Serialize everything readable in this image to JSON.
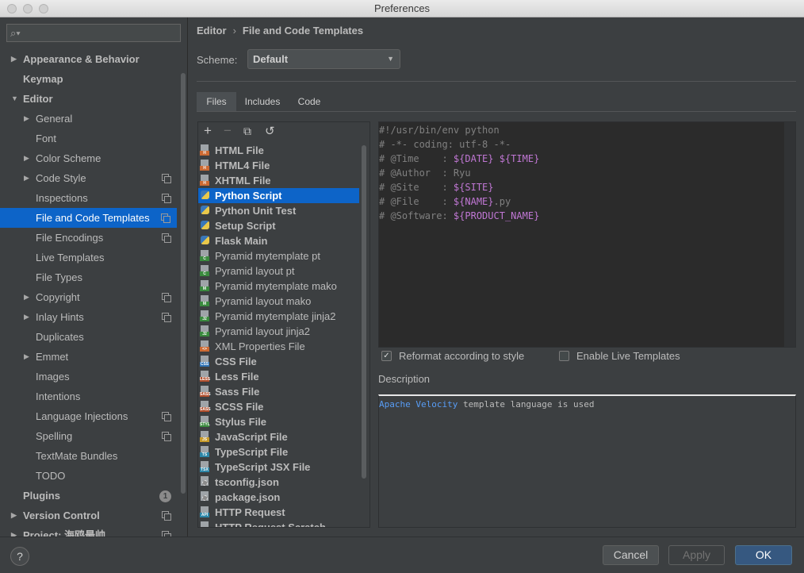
{
  "window": {
    "title": "Preferences"
  },
  "search": {
    "placeholder": ""
  },
  "sidebar": {
    "items": [
      {
        "label": "Appearance & Behavior",
        "bold": true,
        "arrow": "right",
        "level": 0
      },
      {
        "label": "Keymap",
        "bold": true,
        "level": 0
      },
      {
        "label": "Editor",
        "bold": true,
        "arrow": "down",
        "level": 0
      },
      {
        "label": "General",
        "arrow": "right",
        "level": 1
      },
      {
        "label": "Font",
        "level": 1
      },
      {
        "label": "Color Scheme",
        "arrow": "right",
        "level": 1
      },
      {
        "label": "Code Style",
        "arrow": "right",
        "level": 1,
        "copy": true
      },
      {
        "label": "Inspections",
        "level": 1,
        "copy": true
      },
      {
        "label": "File and Code Templates",
        "level": 1,
        "copy": true,
        "selected": true
      },
      {
        "label": "File Encodings",
        "level": 1,
        "copy": true
      },
      {
        "label": "Live Templates",
        "level": 1
      },
      {
        "label": "File Types",
        "level": 1
      },
      {
        "label": "Copyright",
        "arrow": "right",
        "level": 1,
        "copy": true
      },
      {
        "label": "Inlay Hints",
        "arrow": "right",
        "level": 1,
        "copy": true
      },
      {
        "label": "Duplicates",
        "level": 1
      },
      {
        "label": "Emmet",
        "arrow": "right",
        "level": 1
      },
      {
        "label": "Images",
        "level": 1
      },
      {
        "label": "Intentions",
        "level": 1
      },
      {
        "label": "Language Injections",
        "level": 1,
        "copy": true
      },
      {
        "label": "Spelling",
        "level": 1,
        "copy": true
      },
      {
        "label": "TextMate Bundles",
        "level": 1
      },
      {
        "label": "TODO",
        "level": 1
      },
      {
        "label": "Plugins",
        "bold": true,
        "level": 0,
        "badge": "1"
      },
      {
        "label": "Version Control",
        "bold": true,
        "arrow": "right",
        "level": 0,
        "copy": true
      },
      {
        "label": "Project: 海鸥最帅",
        "bold": true,
        "arrow": "right",
        "level": 0,
        "copy": true
      }
    ]
  },
  "breadcrumb": {
    "parent": "Editor",
    "separator": "›",
    "current": "File and Code Templates"
  },
  "scheme": {
    "label": "Scheme:",
    "value": "Default"
  },
  "tabs": [
    {
      "label": "Files",
      "active": true
    },
    {
      "label": "Includes"
    },
    {
      "label": "Code"
    }
  ],
  "toolbar": {
    "add": "+",
    "remove": "−",
    "copy": "⧉",
    "reset": "↺"
  },
  "files": [
    {
      "label": "HTML File",
      "bold": true,
      "icon": "html-file-icon",
      "tag": "H",
      "color": "#cc6a33"
    },
    {
      "label": "HTML4 File",
      "bold": true,
      "icon": "html-file-icon",
      "tag": "H",
      "color": "#cc6a33"
    },
    {
      "label": "XHTML File",
      "bold": true,
      "icon": "html-file-icon",
      "tag": "H",
      "color": "#cc6a33"
    },
    {
      "label": "Python Script",
      "bold": true,
      "icon": "python-icon",
      "selected": true
    },
    {
      "label": "Python Unit Test",
      "bold": true,
      "icon": "python-icon"
    },
    {
      "label": "Setup Script",
      "bold": true,
      "icon": "python-icon"
    },
    {
      "label": "Flask Main",
      "bold": true,
      "icon": "python-icon"
    },
    {
      "label": "Pyramid mytemplate pt",
      "icon": "chameleon-file-icon",
      "tag": "C",
      "color": "#3a8a3e"
    },
    {
      "label": "Pyramid layout pt",
      "icon": "chameleon-file-icon",
      "tag": "C",
      "color": "#3a8a3e"
    },
    {
      "label": "Pyramid mytemplate mako",
      "icon": "mako-file-icon",
      "tag": "M",
      "color": "#3a8a3e"
    },
    {
      "label": "Pyramid layout mako",
      "icon": "mako-file-icon",
      "tag": "M",
      "color": "#3a8a3e"
    },
    {
      "label": "Pyramid mytemplate jinja2",
      "icon": "jinja-file-icon",
      "tag": "J2",
      "color": "#3a8a3e"
    },
    {
      "label": "Pyramid layout jinja2",
      "icon": "jinja-file-icon",
      "tag": "J2",
      "color": "#3a8a3e"
    },
    {
      "label": "XML Properties File",
      "icon": "xml-file-icon",
      "tag": "<>",
      "color": "#cc6a33"
    },
    {
      "label": "CSS File",
      "bold": true,
      "icon": "css-file-icon",
      "tag": "CSS",
      "color": "#2f73b5"
    },
    {
      "label": "Less File",
      "bold": true,
      "icon": "less-file-icon",
      "tag": "LESS",
      "color": "#b04e2c"
    },
    {
      "label": "Sass File",
      "bold": true,
      "icon": "sass-file-icon",
      "tag": "SASS",
      "color": "#b04e2c"
    },
    {
      "label": "SCSS File",
      "bold": true,
      "icon": "scss-file-icon",
      "tag": "SASS",
      "color": "#b04e2c"
    },
    {
      "label": "Stylus File",
      "bold": true,
      "icon": "stylus-file-icon",
      "tag": "STYL",
      "color": "#3a8a3e"
    },
    {
      "label": "JavaScript File",
      "bold": true,
      "icon": "js-file-icon",
      "tag": "JS",
      "color": "#c79a2a"
    },
    {
      "label": "TypeScript File",
      "bold": true,
      "icon": "ts-file-icon",
      "tag": "TS",
      "color": "#2c86a8"
    },
    {
      "label": "TypeScript JSX File",
      "bold": true,
      "icon": "tsx-file-icon",
      "tag": "TSX",
      "color": "#2c86a8"
    },
    {
      "label": "tsconfig.json",
      "bold": true,
      "icon": "config-gear-icon"
    },
    {
      "label": "package.json",
      "bold": true,
      "icon": "config-gear-icon"
    },
    {
      "label": "HTTP Request",
      "bold": true,
      "icon": "api-file-icon",
      "tag": "API",
      "color": "#2c86a8"
    },
    {
      "label": "HTTP Request Scratch",
      "bold": true,
      "icon": "api-file-icon",
      "tag": "API",
      "color": "#2c86a8"
    }
  ],
  "editor": {
    "lines": [
      [
        {
          "t": "#!/usr/bin/env python",
          "c": "c-txt"
        }
      ],
      [
        {
          "t": "# -*- coding: utf-8 -*-",
          "c": "c-txt"
        }
      ],
      [
        {
          "t": "# @Time    : ",
          "c": "c-cm"
        },
        {
          "t": "${DATE}",
          "c": "c-var"
        },
        {
          "t": " ",
          "c": "c-cm"
        },
        {
          "t": "${TIME}",
          "c": "c-var"
        }
      ],
      [
        {
          "t": "# @Author  : Ryu",
          "c": "c-cm"
        }
      ],
      [
        {
          "t": "# @Site    : ",
          "c": "c-cm"
        },
        {
          "t": "${SITE}",
          "c": "c-var"
        }
      ],
      [
        {
          "t": "# @File    : ",
          "c": "c-cm"
        },
        {
          "t": "${NAME}",
          "c": "c-var"
        },
        {
          "t": ".py",
          "c": "c-cm"
        }
      ],
      [
        {
          "t": "# @Software: ",
          "c": "c-cm"
        },
        {
          "t": "${PRODUCT_NAME}",
          "c": "c-var"
        }
      ]
    ]
  },
  "options": {
    "reformat": {
      "label": "Reformat according to style",
      "checked": true
    },
    "live_templates": {
      "label": "Enable Live Templates",
      "checked": false
    }
  },
  "description": {
    "label": "Description",
    "link": "Apache Velocity",
    "rest": " template language is used"
  },
  "footer": {
    "help": "?",
    "cancel": "Cancel",
    "apply": "Apply",
    "ok": "OK"
  },
  "colors": {
    "selection": "#0d64c8",
    "ok_button": "#365880",
    "link": "#589df6",
    "template_var": "#c077d4"
  }
}
